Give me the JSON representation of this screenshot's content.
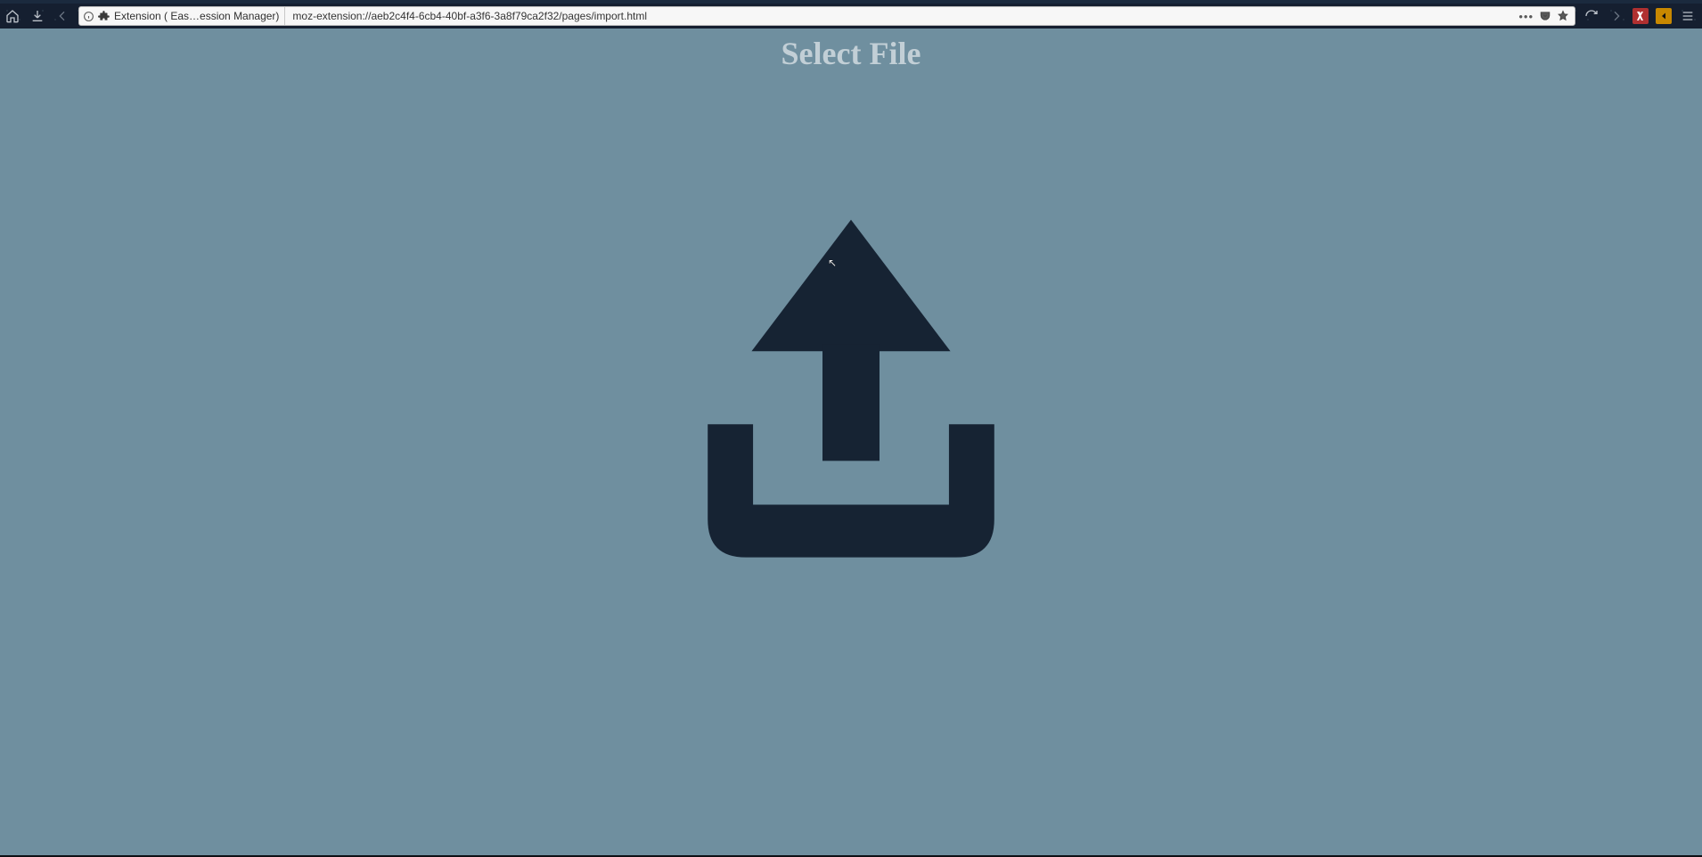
{
  "browser": {
    "identity_label": "Extension ( Eas…ession Manager)",
    "url": "moz-extension://aeb2c4f4-6cb4-40bf-a3f6-3a8f79ca2f32/pages/import.html"
  },
  "page": {
    "title": "Select File"
  }
}
